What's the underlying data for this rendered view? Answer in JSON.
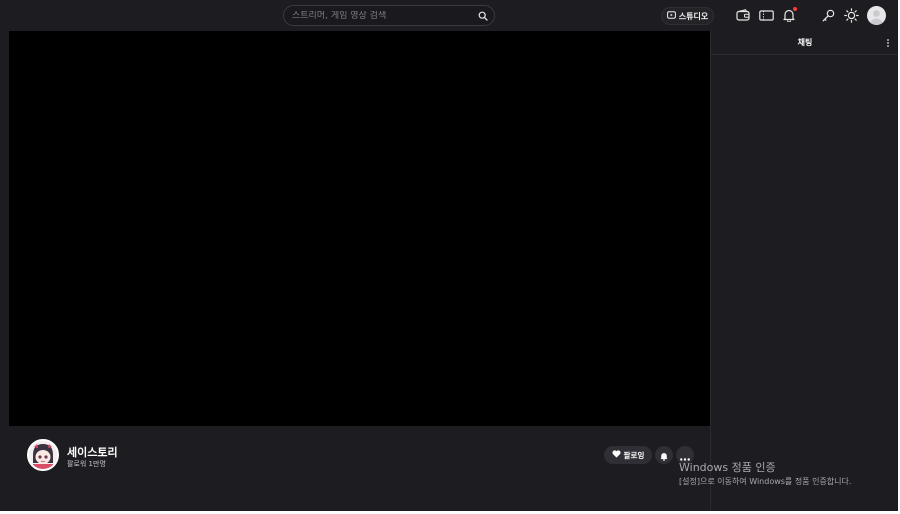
{
  "topbar": {
    "search": {
      "placeholder": "스트리머, 게임 영상 검색"
    },
    "studio_label": "스튜디오",
    "icons": [
      "wallet-icon",
      "ticket-icon",
      "bell-icon",
      "key-icon",
      "sun-icon"
    ]
  },
  "channel": {
    "name": "세이스토리",
    "followers": "팔로워 1만명",
    "follow_label": "팔로잉"
  },
  "chat": {
    "title": "채팅"
  },
  "watermark": {
    "title": "Windows 정품 인증",
    "subtitle": "[설정]으로 이동하여 Windows를 정품 인증합니다."
  },
  "colors": {
    "background": "#1d1d21",
    "player": "#000000",
    "notification_dot": "#ff3b3b"
  }
}
